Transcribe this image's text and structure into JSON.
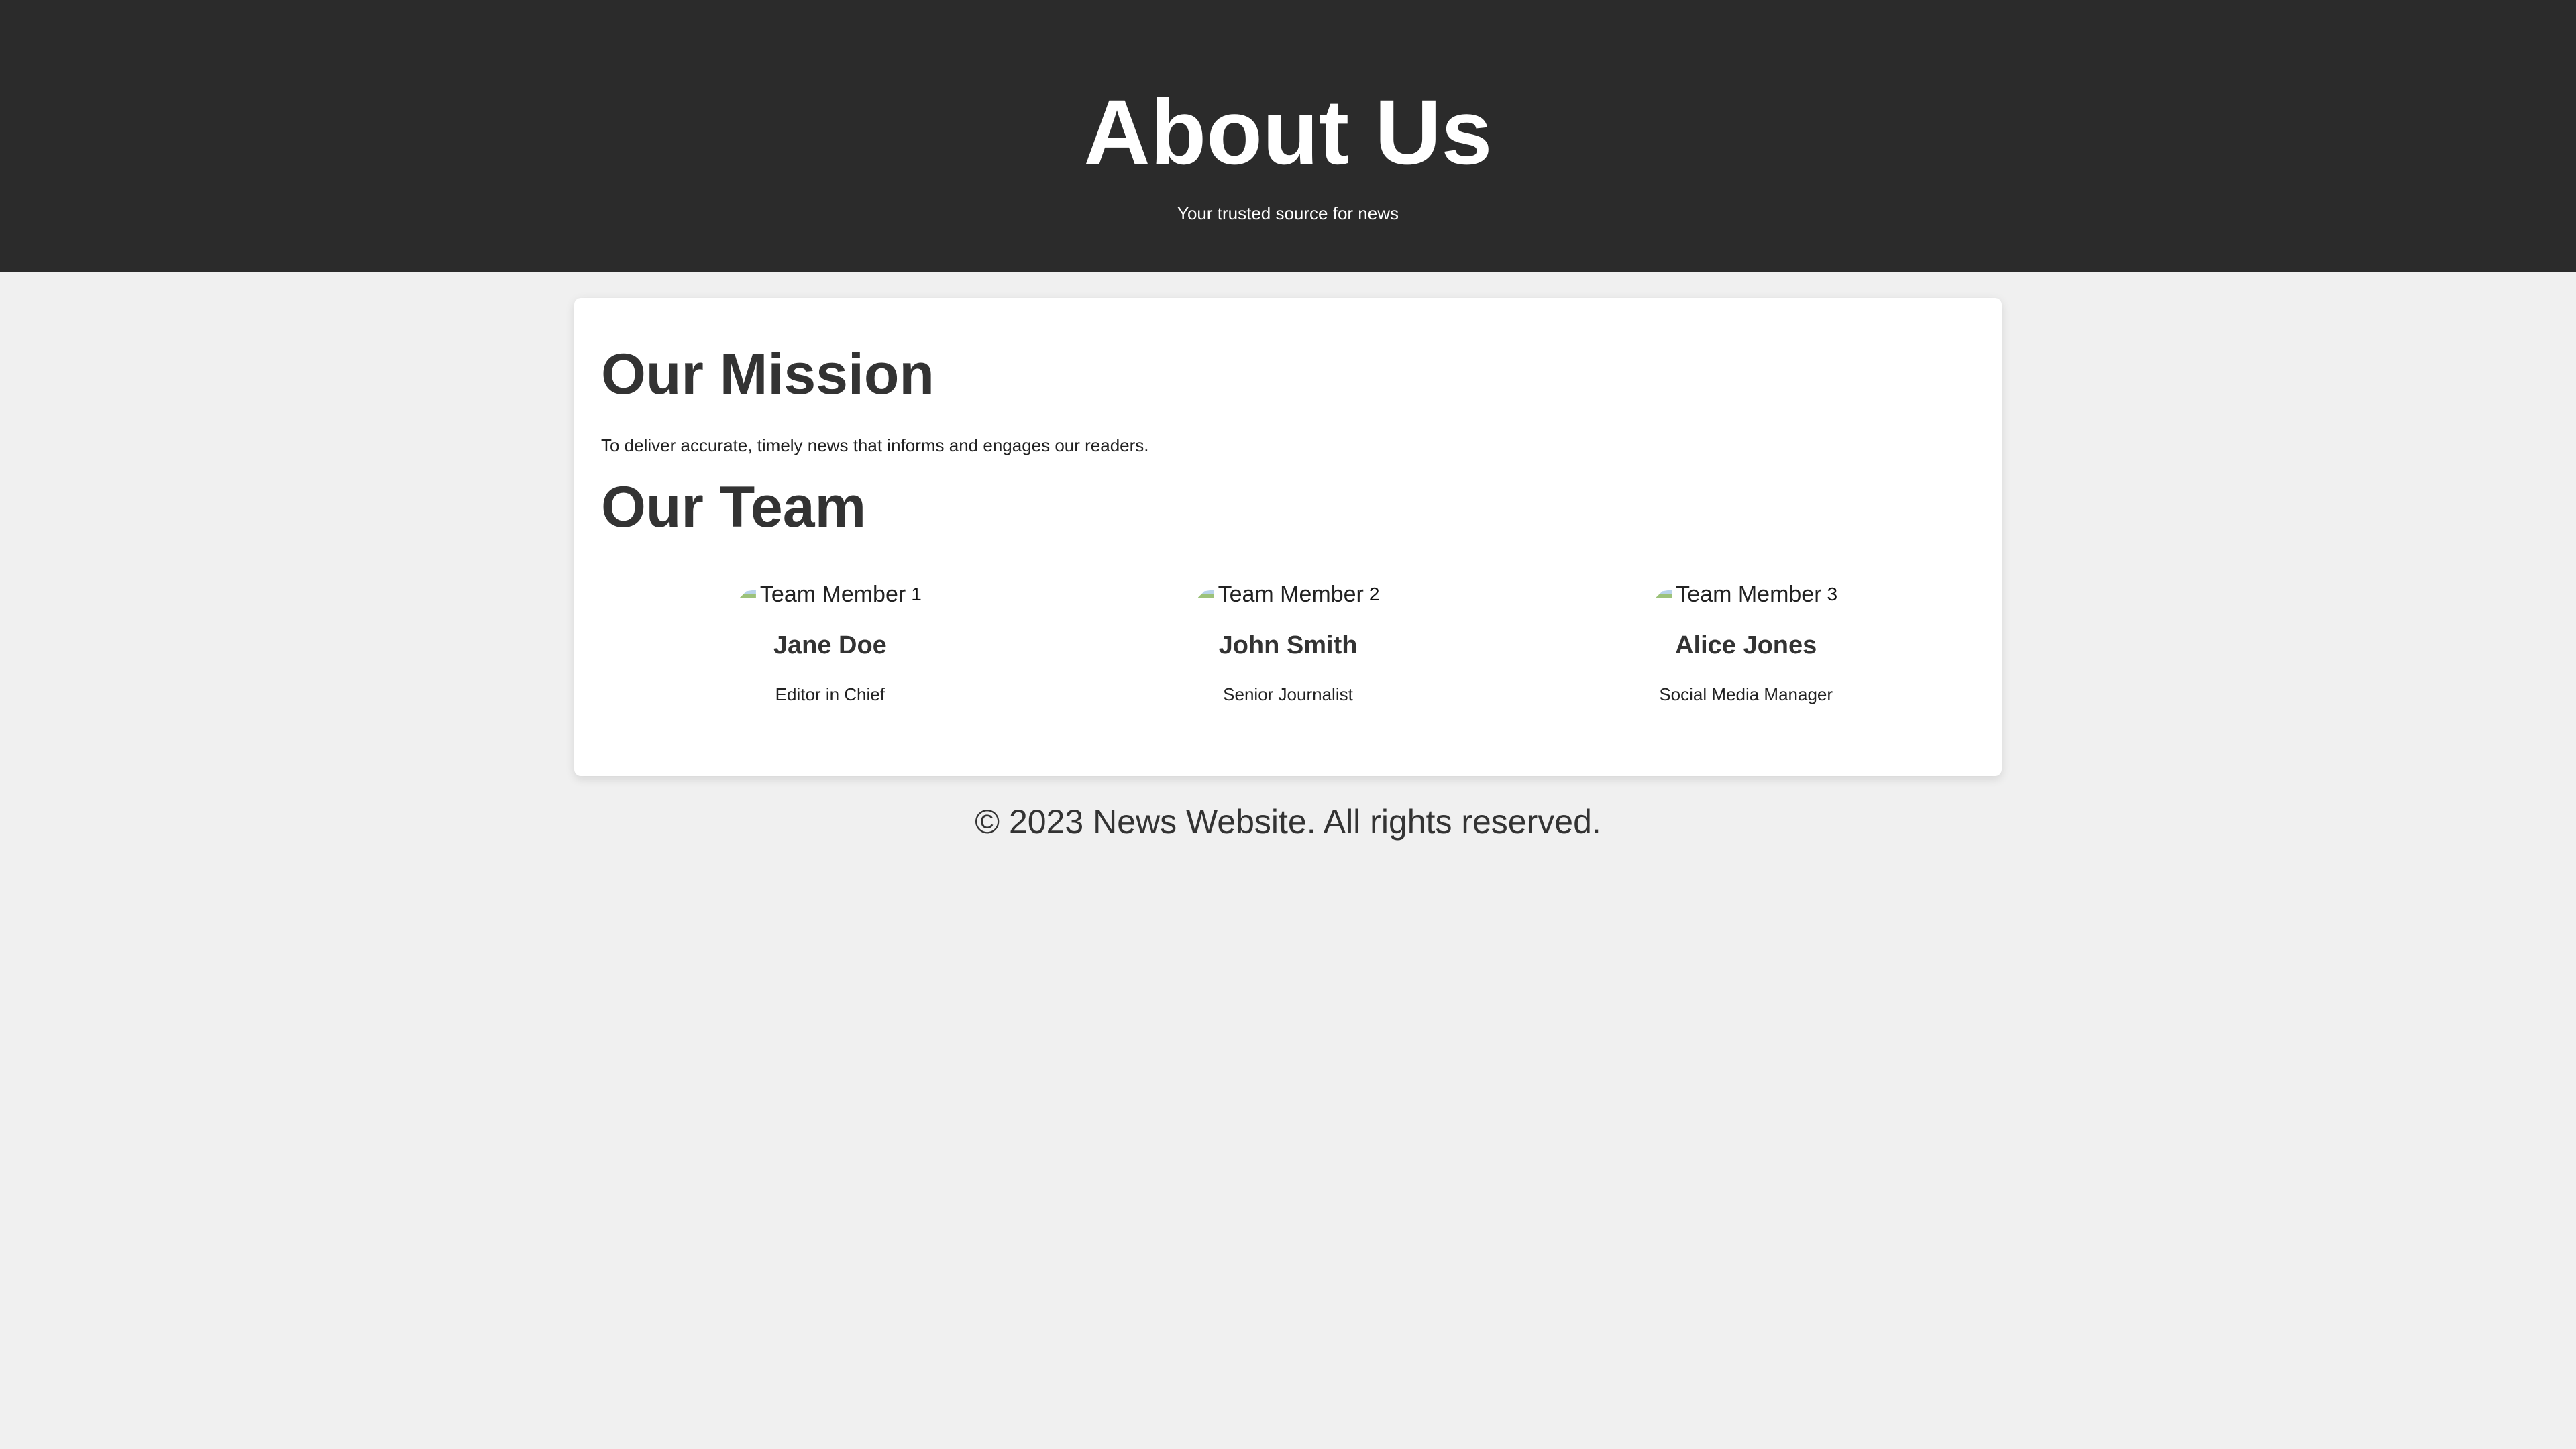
{
  "header": {
    "title": "About Us",
    "subtitle": "Your trusted source for news"
  },
  "mission": {
    "title": "Our Mission",
    "text": "To deliver accurate, timely news that informs and engages our readers."
  },
  "team": {
    "title": "Our Team",
    "members": [
      {
        "photo_alt": "Team Member",
        "photo_alt_tail": "1",
        "name": "Jane Doe",
        "role": "Editor in Chief"
      },
      {
        "photo_alt": "Team Member",
        "photo_alt_tail": "2",
        "name": "John Smith",
        "role": "Senior Journalist"
      },
      {
        "photo_alt": "Team Member",
        "photo_alt_tail": "3",
        "name": "Alice Jones",
        "role": "Social Media Manager"
      }
    ]
  },
  "footer": {
    "text": "© 2023 News Website. All rights reserved."
  },
  "colors": {
    "header_bg": "#2b2b2b",
    "page_bg": "#f0f0f0",
    "card_bg": "#ffffff",
    "text": "#333333"
  }
}
